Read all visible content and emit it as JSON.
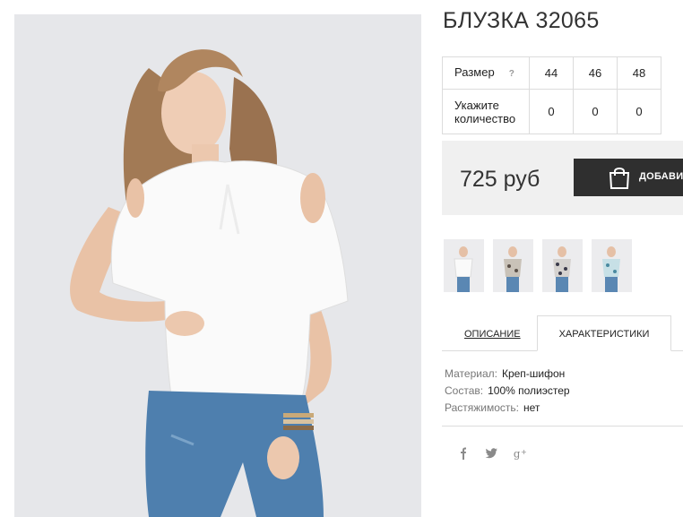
{
  "product": {
    "title": "БЛУЗКА 32065",
    "price": "725 руб",
    "add_to_cart": "ДОБАВИТЬ В КОРЗИНУ"
  },
  "size_table": {
    "size_label": "Размер",
    "help_icon": "?",
    "sizes": [
      "44",
      "46",
      "48"
    ],
    "qty_label": "Укажите количество",
    "quantities": [
      "0",
      "0",
      "0"
    ]
  },
  "tabs": {
    "description": "ОПИСАНИЕ",
    "characteristics": "ХАРАКТЕРИСТИКИ",
    "active": "characteristics"
  },
  "specs": [
    {
      "key": "Материал:",
      "value": "Креп-шифон"
    },
    {
      "key": "Состав:",
      "value": "100% полиэстер"
    },
    {
      "key": "Растяжимость:",
      "value": "нет"
    }
  ],
  "social": [
    "facebook-icon",
    "twitter-icon",
    "google-plus-icon"
  ],
  "colors": {
    "button_bg": "#2f2f2f",
    "price_box_bg": "#f0f0f0",
    "photo_bg": "#e6e7ea"
  }
}
